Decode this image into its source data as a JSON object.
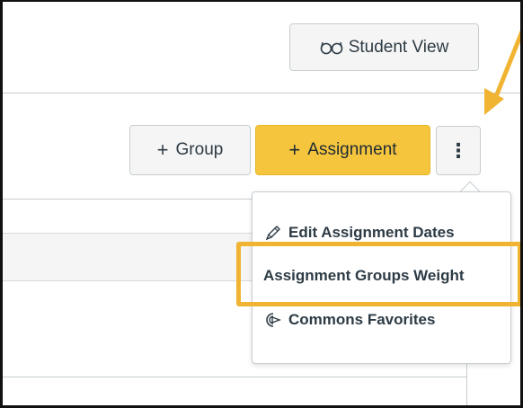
{
  "header": {
    "student_view_label": "Student View",
    "student_view_icon": "glasses-icon"
  },
  "toolbar": {
    "group_label": "Group",
    "assignment_label": "Assignment",
    "more_label": "⋮",
    "accent_color": "#f5c53e"
  },
  "menu": {
    "items": [
      {
        "label": "Edit Assignment Dates",
        "icon": "pencil-icon"
      },
      {
        "label": "Assignment Groups Weight",
        "icon": ""
      },
      {
        "label": "Commons Favorites",
        "icon": "commons-share-icon"
      }
    ]
  },
  "annotation": {
    "highlight_color": "#f0b432",
    "arrow_color": "#f0b432"
  }
}
